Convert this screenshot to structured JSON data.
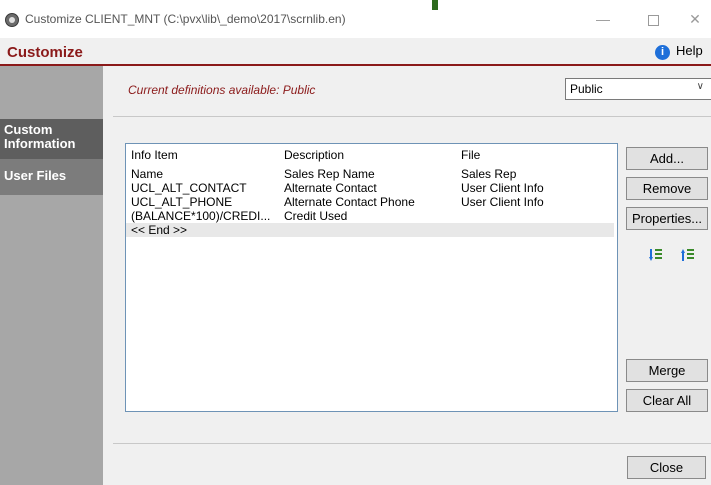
{
  "window": {
    "title": "Customize CLIENT_MNT   (C:\\pvx\\lib\\_demo\\2017\\scrnlib.en)"
  },
  "header": {
    "title": "Customize",
    "help_label": "Help"
  },
  "sidebar": {
    "items": [
      {
        "label": "Custom Information"
      },
      {
        "label": "User Files"
      }
    ]
  },
  "main": {
    "current_definitions": "Current definitions available: Public",
    "definitions_select": {
      "value": "Public"
    },
    "list": {
      "columns": [
        "Info Item",
        "Description",
        "File"
      ],
      "rows": [
        [
          "Name",
          "Sales Rep Name",
          "Sales Rep"
        ],
        [
          "UCL_ALT_CONTACT",
          "Alternate Contact",
          "User Client Info"
        ],
        [
          "UCL_ALT_PHONE",
          "Alternate Contact Phone",
          "User Client Info"
        ],
        [
          "(BALANCE*100)/CREDI...",
          "Credit Used",
          ""
        ],
        [
          "<< End >>",
          "",
          ""
        ]
      ]
    },
    "buttons": {
      "add": "Add...",
      "remove": "Remove",
      "properties": "Properties...",
      "merge": "Merge",
      "clear_all": "Clear All",
      "close": "Close"
    }
  },
  "colors": {
    "accent": "#8b1a1a",
    "sidebar_bg": "#a7a7a7",
    "sidebar_active": "#5e5e5e"
  }
}
